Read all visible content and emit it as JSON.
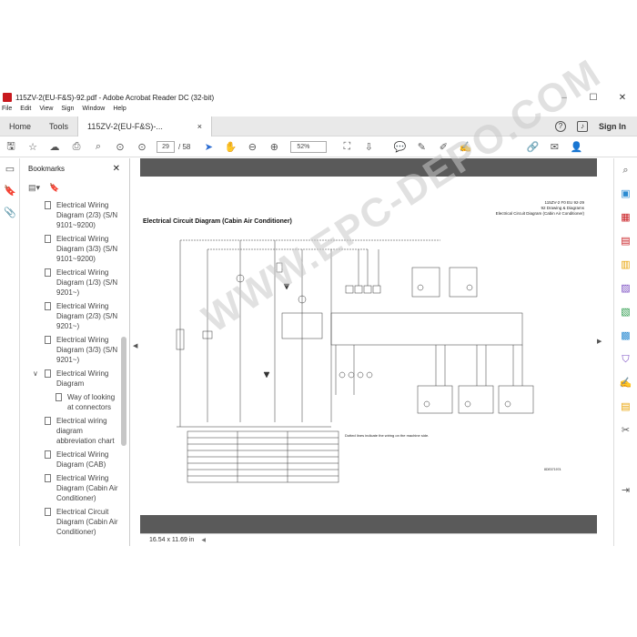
{
  "window": {
    "title": "115ZV-2(EU-F&S)-92.pdf - Adobe Acrobat Reader DC (32-bit)",
    "controls": [
      "–",
      "☐",
      "✕"
    ]
  },
  "menu": [
    "File",
    "Edit",
    "View",
    "Sign",
    "Window",
    "Help"
  ],
  "tabs": {
    "home": "Home",
    "tools": "Tools",
    "document": "115ZV-2(EU-F&S)-...",
    "document_close": "×",
    "sign_in": "Sign In"
  },
  "toolbar": {
    "page_current": "29",
    "page_total": "/ 58",
    "zoom": "52%"
  },
  "bookmarks": {
    "title": "Bookmarks",
    "items": [
      {
        "label": "Electrical Wiring Diagram (2/3) (S/N 9101~9200)",
        "level": 1
      },
      {
        "label": "Electrical Wiring Diagram (3/3) (S/N 9101~9200)",
        "level": 1
      },
      {
        "label": "Electrical Wiring Diagram (1/3) (S/N 9201~)",
        "level": 1
      },
      {
        "label": "Electrical Wiring Diagram (2/3) (S/N 9201~)",
        "level": 1
      },
      {
        "label": "Electrical Wiring Diagram (3/3) (S/N 9201~)",
        "level": 1
      },
      {
        "label": "Electrical Wiring Diagram",
        "level": 0
      },
      {
        "label": "Way of looking at connectors",
        "level": 2
      },
      {
        "label": "Electrical wiring diagram abbreviation chart",
        "level": 1
      },
      {
        "label": "Electrical Wiring Diagram (CAB)",
        "level": 1
      },
      {
        "label": "Electrical Wiring Diagram (Cabin Air Conditioner)",
        "level": 1
      },
      {
        "label": "Electrical Circuit Diagram (Cabin Air Conditioner)",
        "level": 1
      }
    ]
  },
  "page": {
    "header_line1": "115ZV-2 F0 EU 92-29",
    "header_line2": "92 Drawing & Diagrams",
    "header_line3": "Electrical Circuit Diagram (Cabin Air Conditioner)",
    "title": "Electrical Circuit Diagram (Cabin Air Conditioner)",
    "note": "Dotted lines indicate the wiring on the machine side.",
    "code": "8DE071974",
    "watermark": "WWW.EPC-DEPO.COM"
  },
  "status": {
    "page_size": "16.54 x 11.69 in"
  },
  "colors": {
    "accent": "#2a6bd1",
    "viewer_bg": "#5a5a5a",
    "brand_red": "#c8191e"
  }
}
